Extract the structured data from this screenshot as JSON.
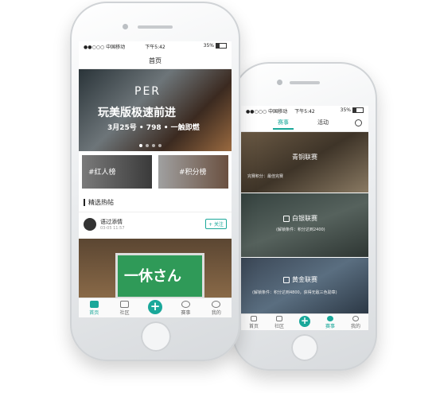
{
  "phone_left": {
    "status": {
      "carrier": "●●○○○ 中国移动",
      "time": "下午5:42",
      "battery": "35%"
    },
    "nav_title": "首页",
    "banner": {
      "brand": "PER",
      "headline": "玩美版极速前进",
      "subline": "3月25号 • 798 • 一触即燃"
    },
    "cards": [
      {
        "label": "#红人榜"
      },
      {
        "label": "#积分榜"
      }
    ],
    "section_title": "精选热帖",
    "post": {
      "username": "语过添情",
      "timestamp": "03-05 11:57",
      "follow_label": "+ 关注",
      "image_text": "一休さん"
    },
    "tabs": [
      {
        "label": "首页",
        "icon": "home-icon"
      },
      {
        "label": "社区",
        "icon": "chat-icon"
      },
      {
        "label": "",
        "icon": "plus-icon"
      },
      {
        "label": "赛事",
        "icon": "medal-icon"
      },
      {
        "label": "我的",
        "icon": "user-icon"
      }
    ]
  },
  "phone_right": {
    "status": {
      "carrier": "●●○○○ 中国移动",
      "time": "下午5:42",
      "battery": "35%"
    },
    "top_tabs": [
      "赛事",
      "活动"
    ],
    "events": [
      {
        "title": "青铜联赛",
        "note": "完赛积分：最佳完赛"
      },
      {
        "title": "白银联赛",
        "note": "(解锁条件：积分达到2400)"
      },
      {
        "title": "黄金联赛",
        "note": "(解锁条件：积分达到4800，获得无敌三色勋章)"
      }
    ],
    "tabs": [
      {
        "label": "首页",
        "icon": "home-icon"
      },
      {
        "label": "社区",
        "icon": "chat-icon"
      },
      {
        "label": "",
        "icon": "plus-icon"
      },
      {
        "label": "赛事",
        "icon": "medal-icon"
      },
      {
        "label": "我的",
        "icon": "user-icon"
      }
    ]
  },
  "colors": {
    "accent": "#1aa89a"
  }
}
